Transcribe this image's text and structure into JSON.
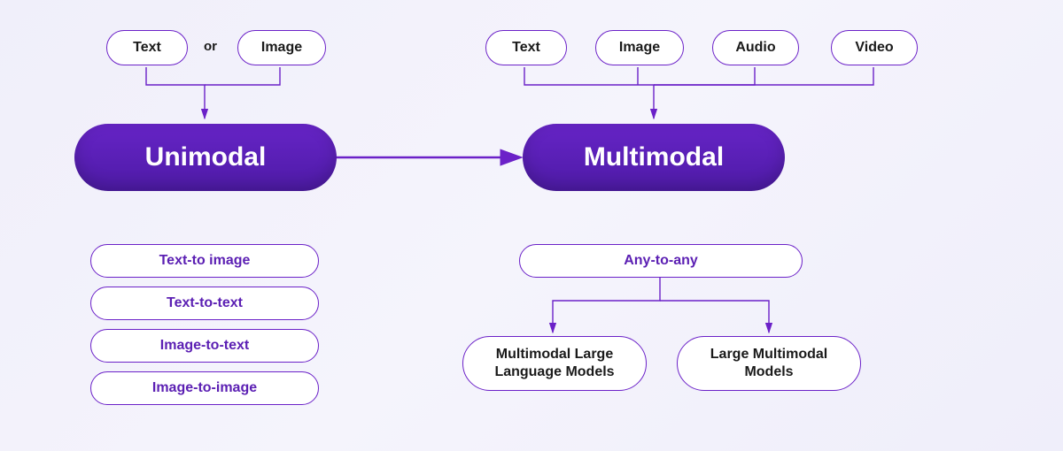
{
  "unimodal": {
    "label": "Unimodal",
    "inputs": {
      "text": "Text",
      "image": "Image",
      "or": "or"
    },
    "capabilities": [
      "Text-to image",
      "Text-to-text",
      "Image-to-text",
      "Image-to-image"
    ]
  },
  "multimodal": {
    "label": "Multimodal",
    "inputs": {
      "text": "Text",
      "image": "Image",
      "audio": "Audio",
      "video": "Video"
    },
    "capability": "Any-to-any",
    "models": {
      "left": "Multimodal Large\nLanguage Models",
      "right": "Large Multimodal\nModels"
    }
  },
  "colors": {
    "purple": "#6b21c8",
    "purple_dark": "#4e1ba7",
    "purple_text": "#5b1fb3"
  }
}
